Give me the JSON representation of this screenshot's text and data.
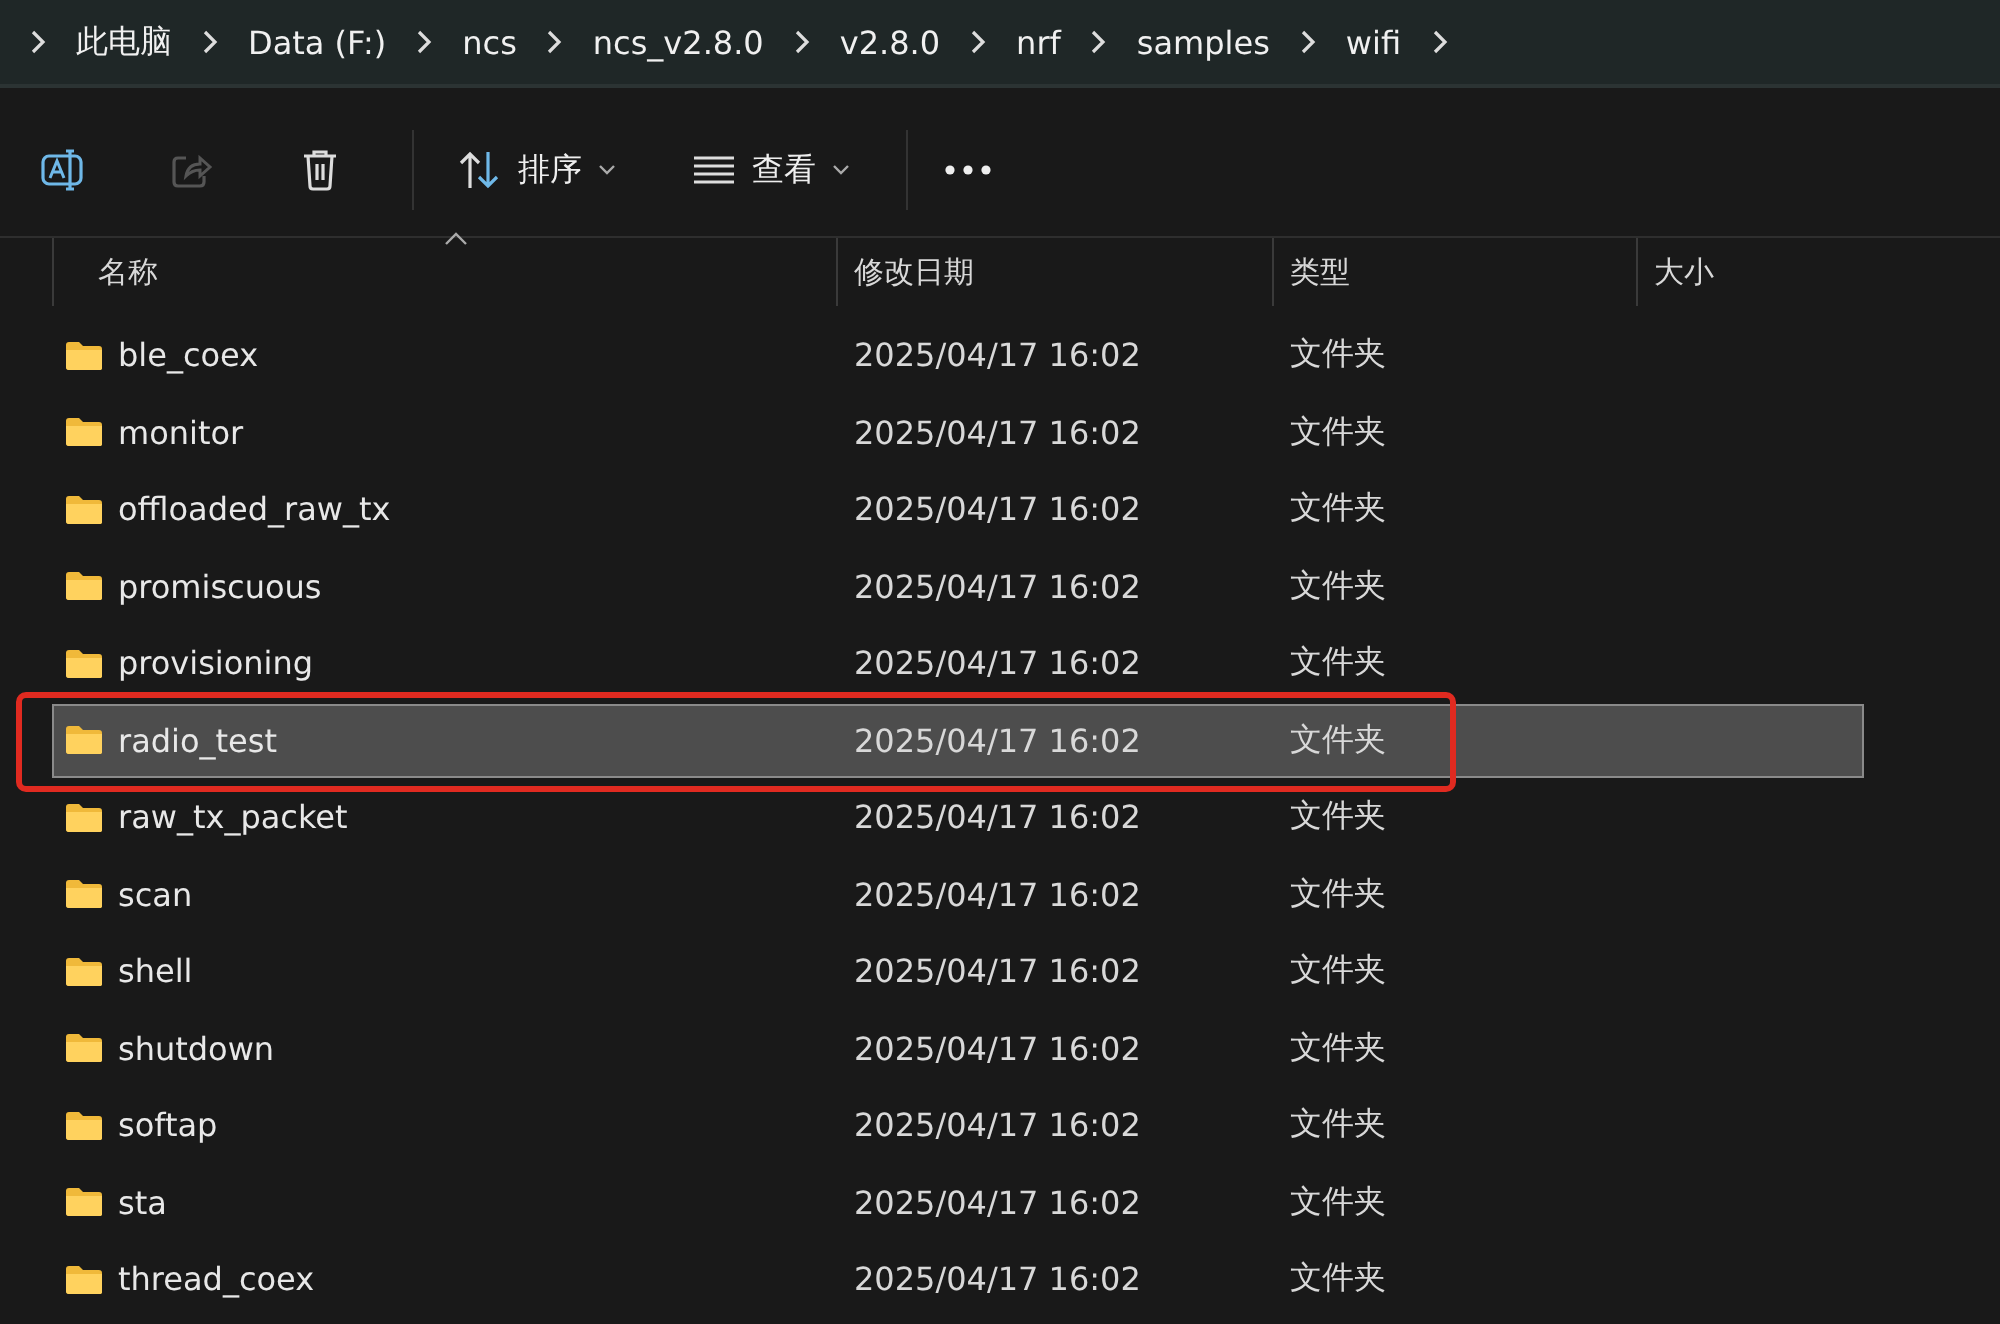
{
  "breadcrumb": [
    "此电脑",
    "Data (F:)",
    "ncs",
    "ncs_v2.8.0",
    "v2.8.0",
    "nrf",
    "samples",
    "wifi"
  ],
  "toolbar": {
    "sort": "排序",
    "view": "查看"
  },
  "columns": [
    {
      "label": "名称",
      "sorted": true
    },
    {
      "label": "修改日期",
      "sorted": false
    },
    {
      "label": "类型",
      "sorted": false
    },
    {
      "label": "大小",
      "sorted": false
    }
  ],
  "rows": [
    {
      "name": "ble_coex",
      "modified": "2025/04/17 16:02",
      "type": "文件夹",
      "selected": false,
      "annotated": false
    },
    {
      "name": "monitor",
      "modified": "2025/04/17 16:02",
      "type": "文件夹",
      "selected": false,
      "annotated": false
    },
    {
      "name": "offloaded_raw_tx",
      "modified": "2025/04/17 16:02",
      "type": "文件夹",
      "selected": false,
      "annotated": false
    },
    {
      "name": "promiscuous",
      "modified": "2025/04/17 16:02",
      "type": "文件夹",
      "selected": false,
      "annotated": false
    },
    {
      "name": "provisioning",
      "modified": "2025/04/17 16:02",
      "type": "文件夹",
      "selected": false,
      "annotated": false
    },
    {
      "name": "radio_test",
      "modified": "2025/04/17 16:02",
      "type": "文件夹",
      "selected": true,
      "annotated": true
    },
    {
      "name": "raw_tx_packet",
      "modified": "2025/04/17 16:02",
      "type": "文件夹",
      "selected": false,
      "annotated": false
    },
    {
      "name": "scan",
      "modified": "2025/04/17 16:02",
      "type": "文件夹",
      "selected": false,
      "annotated": false
    },
    {
      "name": "shell",
      "modified": "2025/04/17 16:02",
      "type": "文件夹",
      "selected": false,
      "annotated": false
    },
    {
      "name": "shutdown",
      "modified": "2025/04/17 16:02",
      "type": "文件夹",
      "selected": false,
      "annotated": false
    },
    {
      "name": "softap",
      "modified": "2025/04/17 16:02",
      "type": "文件夹",
      "selected": false,
      "annotated": false
    },
    {
      "name": "sta",
      "modified": "2025/04/17 16:02",
      "type": "文件夹",
      "selected": false,
      "annotated": false
    },
    {
      "name": "thread_coex",
      "modified": "2025/04/17 16:02",
      "type": "文件夹",
      "selected": false,
      "annotated": false
    }
  ]
}
